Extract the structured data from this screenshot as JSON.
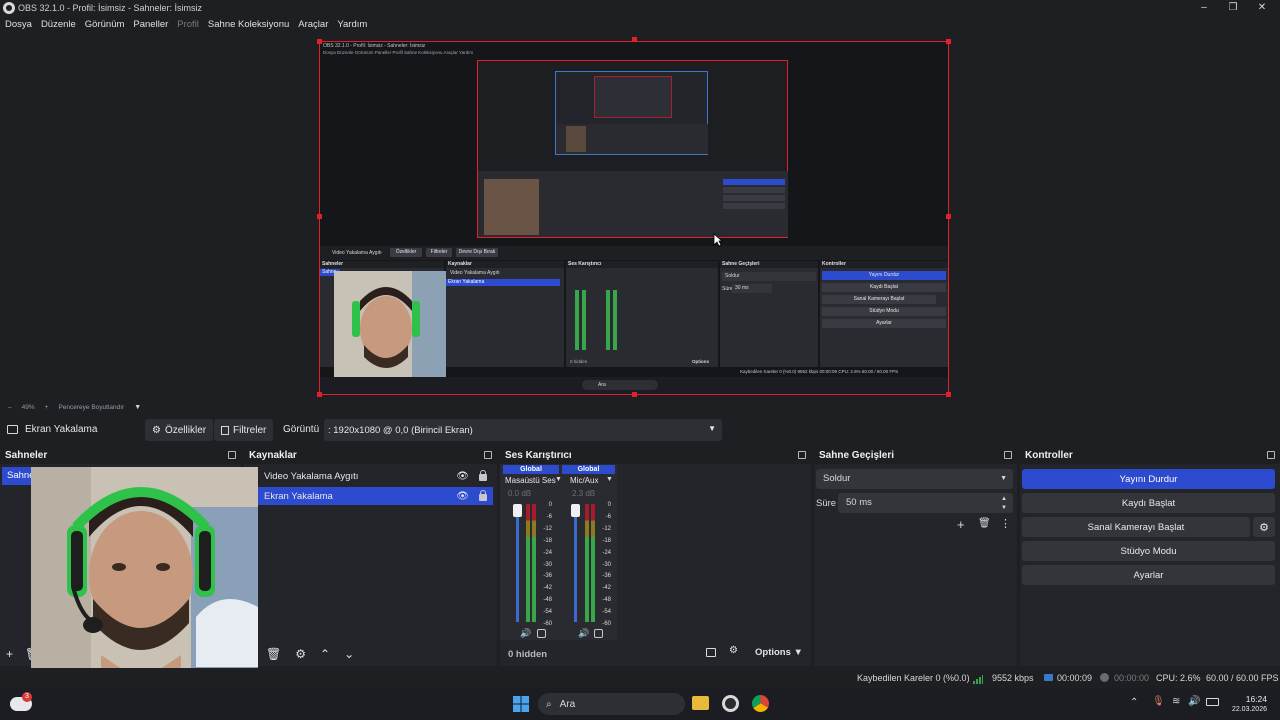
{
  "window": {
    "title": "OBS 32.1.0 - Profil: İsimsiz - Sahneler: İsimsiz"
  },
  "menu": [
    "Dosya",
    "Düzenle",
    "Görünüm",
    "Paneller",
    "Profil",
    "Sahne Koleksiyonu",
    "Araçlar",
    "Yardım"
  ],
  "mini": {
    "title": "OBS 32.1.0 - Profil: İsimsiz - Sahneler: İsimsiz",
    "menu": "Dosya  Düzenle  Görünüm  Paneller  Profil  Sahne Koleksiyonu  Araçlar  Yardım",
    "source_name": "Video Yakalama Aygıtı",
    "props": "Özellikler",
    "filters": "Filtreler",
    "deactivate": "Devre Dışı Bırak",
    "scenes": "Sahneler",
    "sources": "Kaynaklar",
    "mixer": "Ses Karıştırıcı",
    "transitions": "Sahne Geçişleri",
    "controls": "Kontroller",
    "src1": "Video Yakalama Aygıtı",
    "src2": "Ekran Yakalama",
    "scene1": "Sahne",
    "fade": "Soldur",
    "duration_label": "Süre",
    "duration": "30 ms",
    "btn1": "Yayını Durdur",
    "btn2": "Kaydı Başlat",
    "btn3": "Sanal Kamerayı Başlat",
    "btn4": "Stüdyo Modu",
    "btn5": "Ayarlar",
    "hidden": "0 hidden",
    "options": "Options",
    "status": "Kaybedilen Kareler 0 (%0.0)   9552 kbps   00:00:09   CPU: 2.6%   60.00 / 60.00 FPS",
    "search": "Ara"
  },
  "zoom": {
    "level": "49%",
    "mode": "Pencereye Boyutlandır"
  },
  "source_toolbar": {
    "source_label": "Ekran Yakalama",
    "properties": "Özellikler",
    "filters": "Filtreler",
    "display_label": "Görüntü",
    "display_value": ": 1920x1080 @ 0,0 (Birincil Ekran)"
  },
  "scenes": {
    "title": "Sahneler",
    "items": [
      "Sahne"
    ]
  },
  "sources": {
    "title": "Kaynaklar",
    "items": [
      {
        "name": "Video Yakalama Aygıtı",
        "selected": false
      },
      {
        "name": "Ekran Yakalama",
        "selected": true
      }
    ]
  },
  "mixer": {
    "title": "Ses Karıştırıcı",
    "channels": [
      {
        "group": "Global",
        "name": "Masaüstü Ses",
        "db": "0.0 dB",
        "level": 0.62
      },
      {
        "group": "Global",
        "name": "Mic/Aux",
        "db": "2.3 dB",
        "level": 0.4
      }
    ],
    "scale": [
      "0",
      "-6",
      "-12",
      "-18",
      "-24",
      "-30",
      "-36",
      "-42",
      "-48",
      "-54",
      "-60"
    ],
    "hidden_label": "0 hidden",
    "options_label": "Options"
  },
  "transitions": {
    "title": "Sahne Geçişleri",
    "selected": "Soldur",
    "duration_label": "Süre",
    "duration_value": "50 ms"
  },
  "controls": {
    "title": "Kontroller",
    "stop_stream": "Yayını Durdur",
    "start_record": "Kaydı Başlat",
    "start_virtualcam": "Sanal Kamerayı Başlat",
    "studio_mode": "Stüdyo Modu",
    "settings": "Ayarlar"
  },
  "status": {
    "dropped": "Kaybedilen Kareler 0 (%0.0)",
    "bitrate": "9552 kbps",
    "stream_time": "00:00:09",
    "record_time": "00:00:00",
    "cpu": "CPU: 2.6%",
    "fps": "60.00 / 60.00 FPS"
  },
  "taskbar": {
    "search_placeholder": "Ara",
    "time": "16:24",
    "date": "22.03.2026",
    "notification_count": "3"
  },
  "colors": {
    "accent": "#2c4bcf",
    "capture_border": "#e0202a",
    "meter_green": "#3aa64a",
    "meter_red": "#a51c2c"
  }
}
